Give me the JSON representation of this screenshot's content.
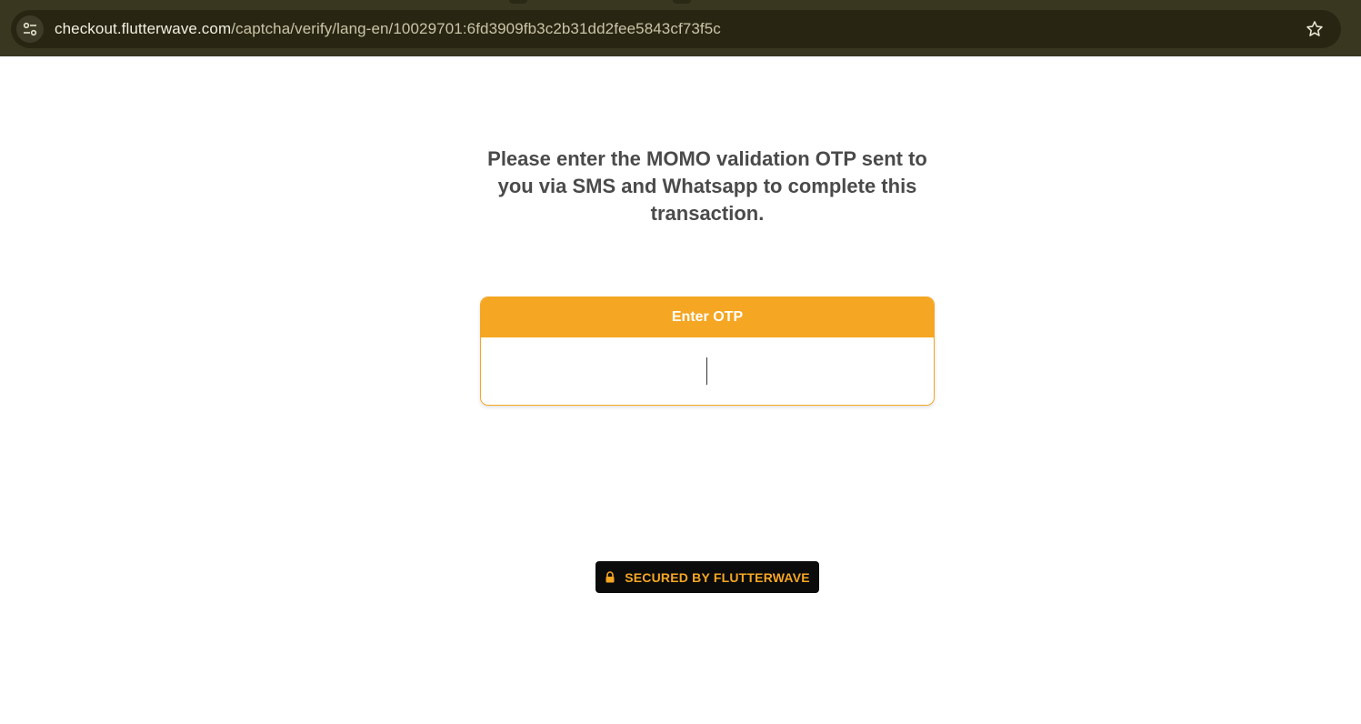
{
  "browser": {
    "url_host": "checkout.flutterwave.com",
    "url_path": "/captcha/verify/lang-en/10029701:6fd3909fb3c2b31dd2fee5843cf73f5c",
    "site_info_icon": "tune-icon",
    "bookmark_icon": "star-icon"
  },
  "page": {
    "message": "Please enter the MOMO validation OTP sent to you via SMS and Whatsapp to complete this transaction.",
    "otp": {
      "label": "Enter OTP",
      "value": "",
      "placeholder": ""
    },
    "secured_badge": {
      "icon": "lock-icon",
      "label": "SECURED BY FLUTTERWAVE"
    }
  },
  "colors": {
    "accent": "#f5a623",
    "badge_bg": "#0b0b0b",
    "heading": "#4a4a4a",
    "browser_chrome": "#3a3720"
  }
}
